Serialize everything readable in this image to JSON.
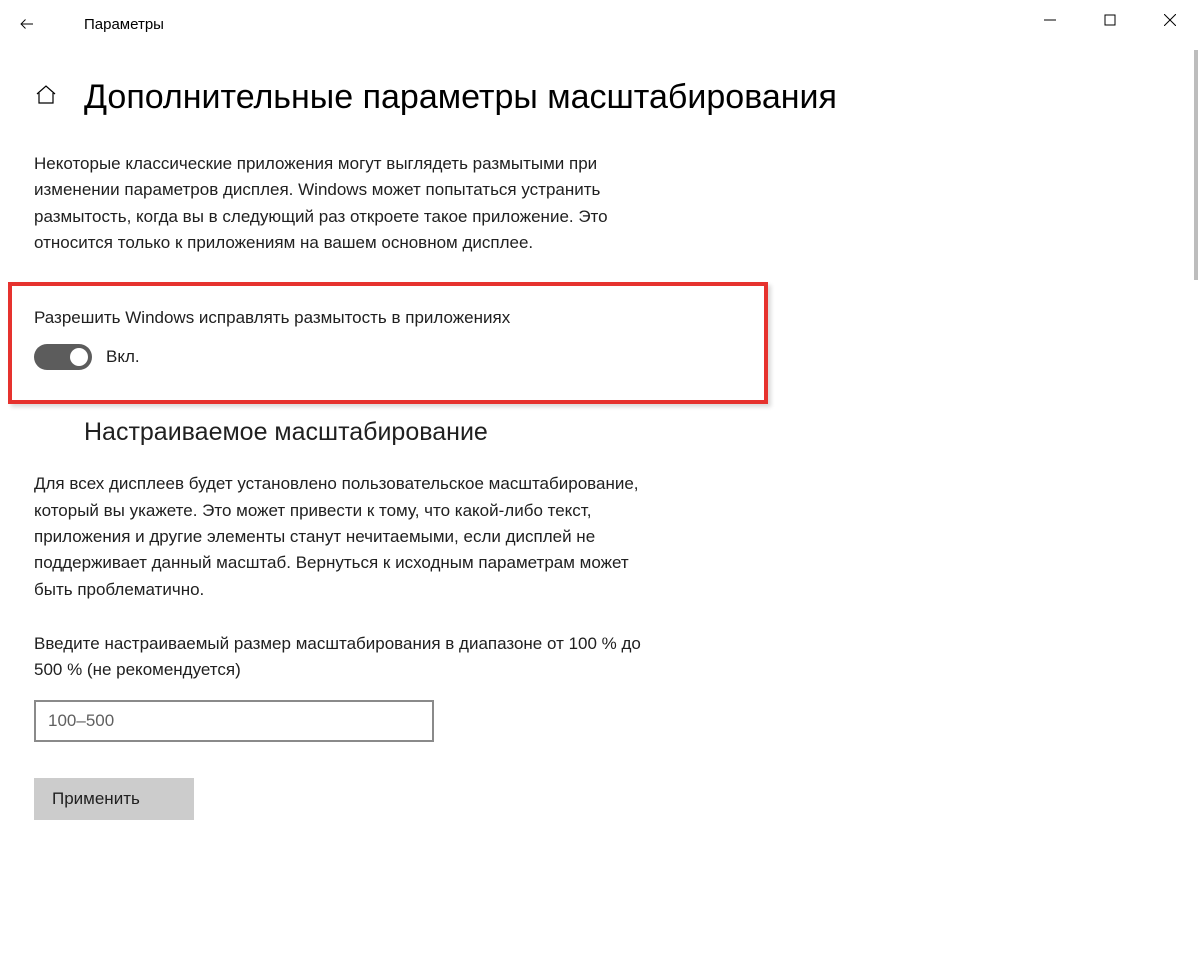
{
  "titlebar": {
    "title": "Параметры"
  },
  "page": {
    "title": "Дополнительные параметры масштабирования"
  },
  "section1": {
    "description": "Некоторые классические приложения могут выглядеть размытыми при изменении параметров дисплея. Windows может попытаться устранить размытость, когда вы в следующий раз откроете такое приложение. Это относится только к приложениям на вашем основном дисплее.",
    "toggle_label": "Разрешить Windows исправлять размытость в приложениях",
    "toggle_state": "Вкл."
  },
  "section2": {
    "heading": "Настраиваемое масштабирование",
    "description": "Для всех дисплеев будет установлено пользовательское масштабирование, который вы укажете. Это может привести к тому, что какой-либо текст, приложения и другие элементы станут нечитаемыми, если дисплей не поддерживает данный масштаб. Вернуться к исходным параметрам может быть проблематично.",
    "input_label": "Введите настраиваемый размер масштабирования в диапазоне от 100 % до 500 % (не рекомендуется)",
    "input_placeholder": "100–500",
    "apply_label": "Применить"
  }
}
